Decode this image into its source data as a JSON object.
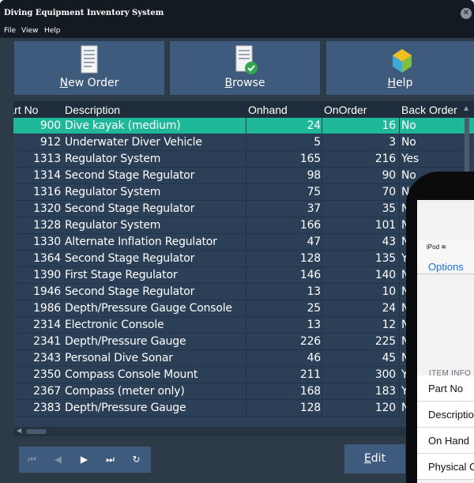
{
  "window": {
    "title": "Diving Equipment Inventory System",
    "close_icon": "close-icon"
  },
  "menu": [
    "File",
    "View",
    "Help"
  ],
  "toolbar": {
    "new_order_pre": "N",
    "new_order_rest": "ew Order",
    "browse_pre": "B",
    "browse_rest": "rowse",
    "help_pre": "H",
    "help_rest": "elp"
  },
  "grid": {
    "columns": [
      "Part No",
      "Description",
      "Onhand",
      "OnOrder",
      "Back Order"
    ],
    "selected_index": 0,
    "rows": [
      {
        "part": "900",
        "desc": "Dive kayak (medium)",
        "onhand": "24",
        "onorder": "16",
        "back": "No"
      },
      {
        "part": "912",
        "desc": "Underwater Diver Vehicle",
        "onhand": "5",
        "onorder": "3",
        "back": "No"
      },
      {
        "part": "1313",
        "desc": "Regulator System",
        "onhand": "165",
        "onorder": "216",
        "back": "Yes"
      },
      {
        "part": "1314",
        "desc": "Second Stage Regulator",
        "onhand": "98",
        "onorder": "90",
        "back": "No"
      },
      {
        "part": "1316",
        "desc": "Regulator System",
        "onhand": "75",
        "onorder": "70",
        "back": "N"
      },
      {
        "part": "1320",
        "desc": "Second Stage Regulator",
        "onhand": "37",
        "onorder": "35",
        "back": "N"
      },
      {
        "part": "1328",
        "desc": "Regulator System",
        "onhand": "166",
        "onorder": "101",
        "back": "N"
      },
      {
        "part": "1330",
        "desc": "Alternate Inflation Regulator",
        "onhand": "47",
        "onorder": "43",
        "back": "N"
      },
      {
        "part": "1364",
        "desc": "Second Stage Regulator",
        "onhand": "128",
        "onorder": "135",
        "back": "Y"
      },
      {
        "part": "1390",
        "desc": "First Stage Regulator",
        "onhand": "146",
        "onorder": "140",
        "back": "N"
      },
      {
        "part": "1946",
        "desc": "Second Stage Regulator",
        "onhand": "13",
        "onorder": "10",
        "back": "N"
      },
      {
        "part": "1986",
        "desc": "Depth/Pressure Gauge Console",
        "onhand": "25",
        "onorder": "24",
        "back": "N"
      },
      {
        "part": "2314",
        "desc": "Electronic Console",
        "onhand": "13",
        "onorder": "12",
        "back": "N"
      },
      {
        "part": "2341",
        "desc": "Depth/Pressure Gauge",
        "onhand": "226",
        "onorder": "225",
        "back": "N"
      },
      {
        "part": "2343",
        "desc": "Personal Dive Sonar",
        "onhand": "46",
        "onorder": "45",
        "back": "N"
      },
      {
        "part": "2350",
        "desc": "Compass Console Mount",
        "onhand": "211",
        "onorder": "300",
        "back": "Y"
      },
      {
        "part": "2367",
        "desc": "Compass (meter only)",
        "onhand": "168",
        "onorder": "183",
        "back": "Y"
      },
      {
        "part": "2383",
        "desc": "Depth/Pressure Gauge",
        "onhand": "128",
        "onorder": "120",
        "back": "N"
      }
    ]
  },
  "nav": {
    "first": "⏮",
    "prev": "◀",
    "next": "▶",
    "last": "⏭",
    "refresh": "↻"
  },
  "edit": {
    "pre": "E",
    "rest": "dit"
  },
  "phone": {
    "status": "iPod",
    "options": "Options",
    "section": "ITEM INFO",
    "cells": [
      "Part No",
      "Description",
      "On Hand",
      "Physical C"
    ]
  },
  "colors": {
    "accent": "#1fb89a",
    "button": "#3e5a7c",
    "background": "#2d3a48"
  }
}
